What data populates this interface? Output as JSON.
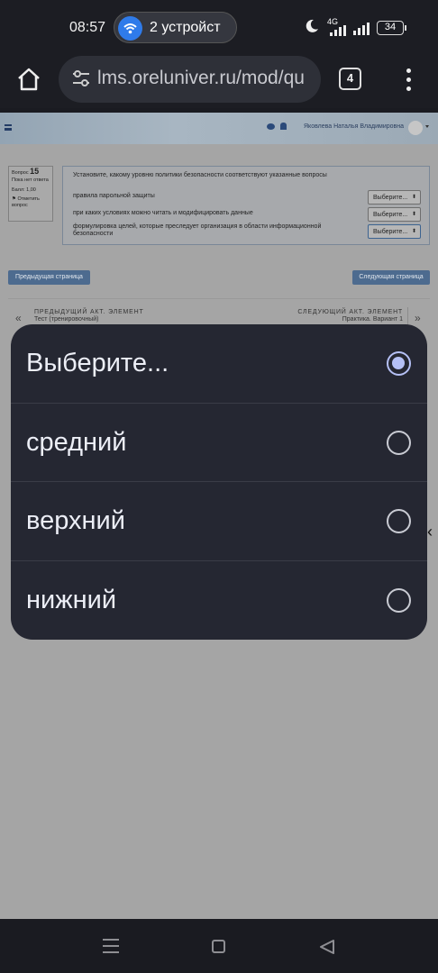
{
  "status_bar": {
    "time": "08:57",
    "cast_text": "2 устройст",
    "network": "4G",
    "battery": "34"
  },
  "browser": {
    "url": "lms.oreluniver.ru/mod/qu",
    "tab_count": "4"
  },
  "site_header": {
    "user_name": "Яковлева Наталья Владимировна"
  },
  "question_info": {
    "label": "Вопрос",
    "number": "15",
    "status": "Пока нет ответа",
    "score": "Балл: 1,00",
    "flag": "Отметить вопрос"
  },
  "question": {
    "text": "Установите, какому уровню политики безопасности соответствуют указанные вопросы",
    "rows": [
      {
        "label": "правила парольной защиты",
        "select": "Выберите..."
      },
      {
        "label": "при каких условиях можно читать и модифицировать данные",
        "select": "Выберите..."
      },
      {
        "label": "формулировка целей, которые преследует организация в области информационной безопасности",
        "select": "Выберите..."
      }
    ]
  },
  "navigation": {
    "prev_page": "Предыдущая страница",
    "next_page": "Следующая страница",
    "prev_caption": "ПРЕДЫДУЩИЙ АКТ. ЭЛЕМЕНТ",
    "prev_title": "Тест (тренировочный)",
    "next_caption": "СЛЕДУЮЩИЙ АКТ. ЭЛЕМЕНТ",
    "next_title": "Практика. Вариант 1"
  },
  "dropdown": {
    "options": [
      {
        "label": "Выберите...",
        "selected": true
      },
      {
        "label": "средний",
        "selected": false
      },
      {
        "label": "верхний",
        "selected": false
      },
      {
        "label": "нижний",
        "selected": false
      }
    ]
  },
  "colors": {
    "dialog_bg": "#252732",
    "accent": "#b5c0f5",
    "button_blue": "#4d6b8f"
  }
}
